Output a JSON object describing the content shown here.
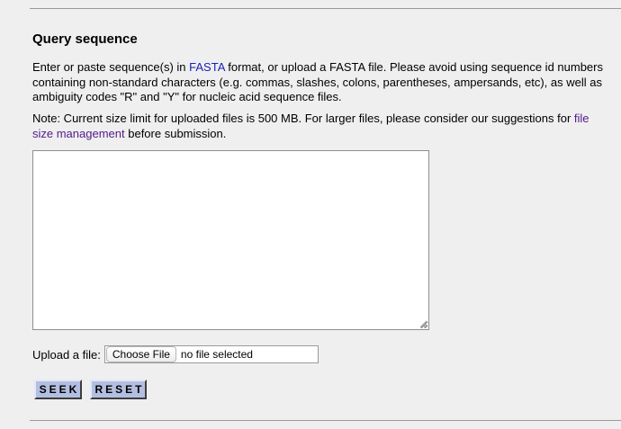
{
  "section": {
    "title": "Query sequence"
  },
  "intro": {
    "text_before_link": "Enter or paste sequence(s) in ",
    "fasta_link": "FASTA",
    "text_after_link": " format, or upload a FASTA file. Please avoid using sequence id numbers containing non-standard characters (e.g. commas, slashes, colons, parentheses, ampersands, etc), as well as ambiguity codes \"R\" and \"Y\" for nucleic acid sequence files."
  },
  "note": {
    "text_before_link": "Note: Current size limit for uploaded files is 500 MB. For larger files, please consider our suggestions for ",
    "link": "file size management",
    "text_after_link": " before submission."
  },
  "sequence_input": {
    "value": "",
    "placeholder": ""
  },
  "upload": {
    "label": "Upload a file:",
    "choose_button": "Choose File",
    "status": "no file selected"
  },
  "actions": {
    "seek_label": "SEEK",
    "reset_label": "RESET"
  },
  "colors": {
    "background": "#efefef",
    "link": "#1a1fb8",
    "visited_link": "#551a8b",
    "button_fill": "#b3bfe0"
  }
}
